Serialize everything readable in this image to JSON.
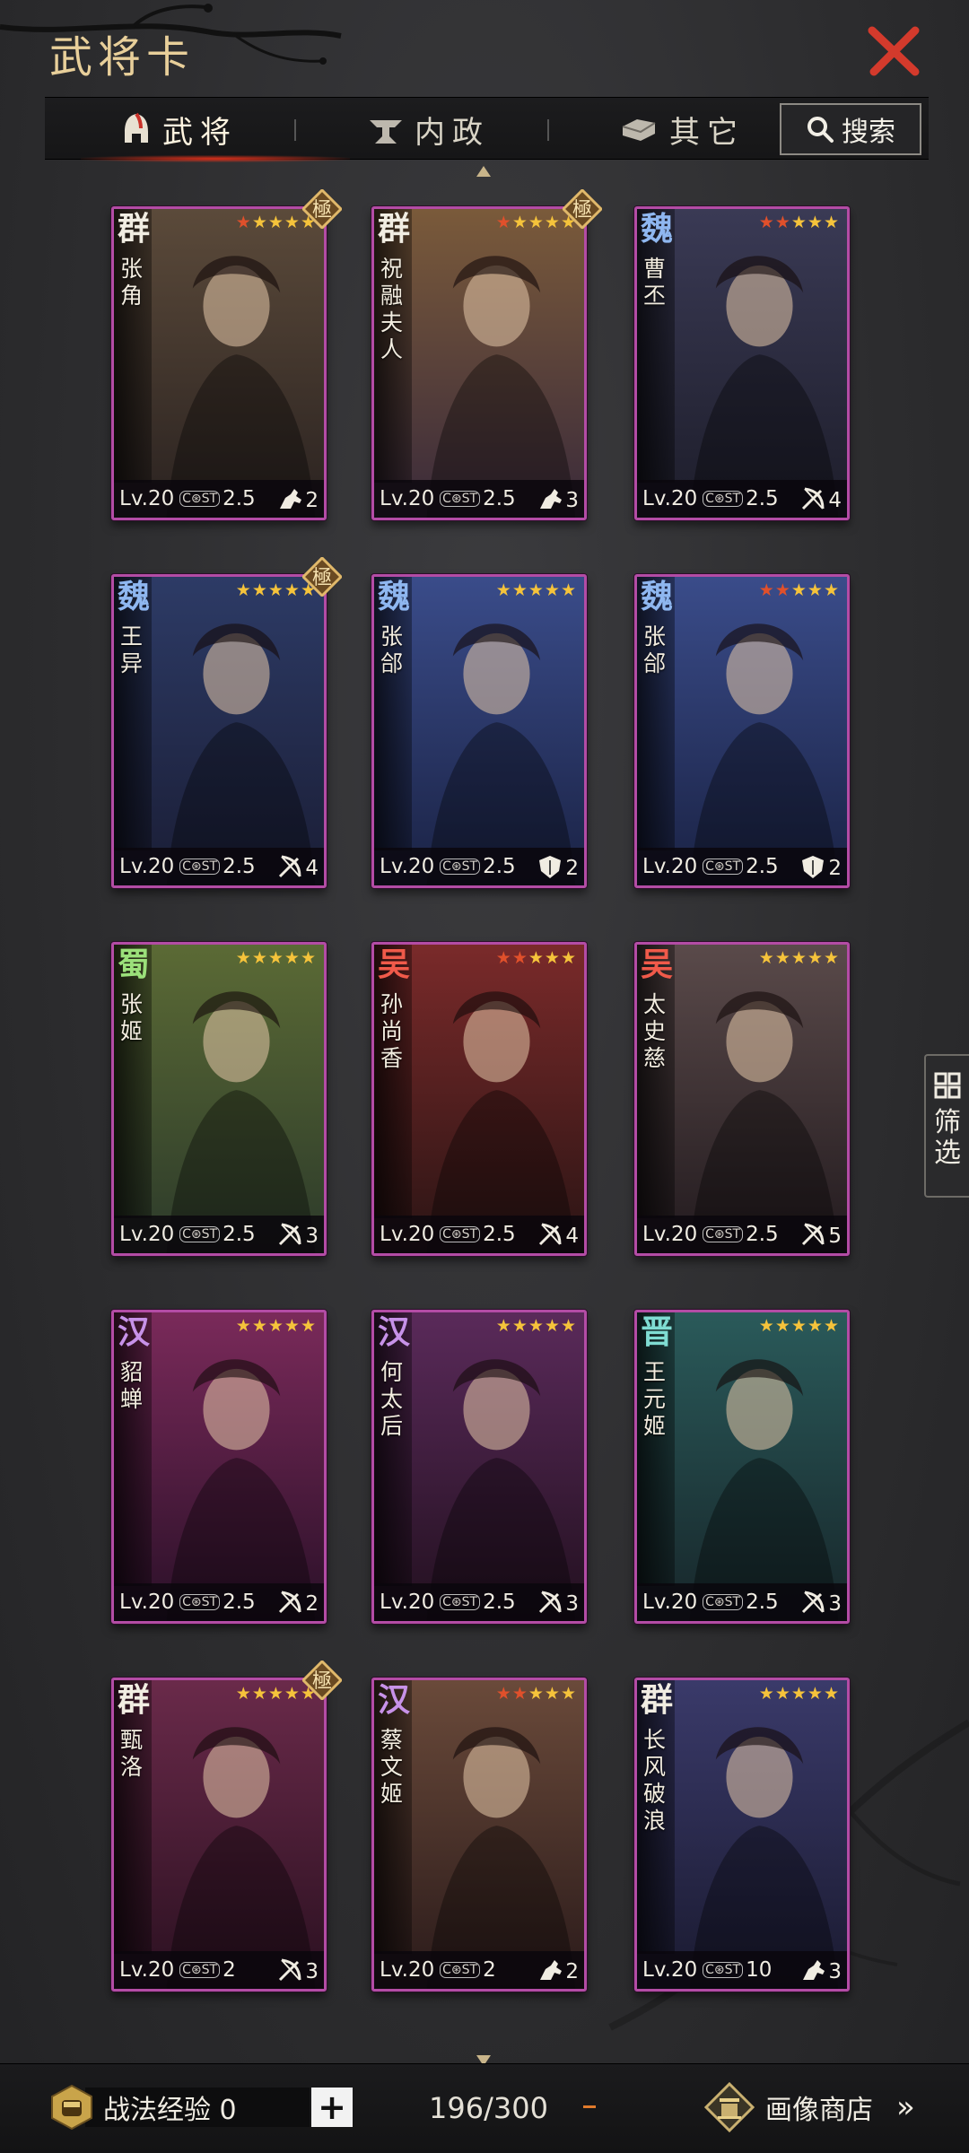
{
  "header": {
    "title": "武将卡"
  },
  "tabs": [
    {
      "label": "武将",
      "icon": "helmet-icon",
      "active": true
    },
    {
      "label": "内政",
      "icon": "anvil-icon",
      "active": false
    },
    {
      "label": "其它",
      "icon": "ingot-icon",
      "active": false
    }
  ],
  "search": {
    "label": "搜索"
  },
  "filter": {
    "label": "筛选"
  },
  "cards": [
    {
      "faction": "群",
      "faction_color": "#f1ede2",
      "name": "张角",
      "stars": 5,
      "red_stars": 1,
      "badge": "極",
      "level": "Lv.20",
      "cost": "2.5",
      "troop_icon": "cavalry-icon",
      "troop_count": "2",
      "art": [
        "#5b4a3a",
        "#2a2220"
      ]
    },
    {
      "faction": "群",
      "faction_color": "#f1ede2",
      "name": "祝融夫人",
      "stars": 5,
      "red_stars": 1,
      "badge": "極",
      "level": "Lv.20",
      "cost": "2.5",
      "troop_icon": "cavalry-icon",
      "troop_count": "3",
      "art": [
        "#7a5a3a",
        "#3a2a3a"
      ]
    },
    {
      "faction": "魏",
      "faction_color": "#8fb7f0",
      "name": "曹丕",
      "stars": 5,
      "red_stars": 2,
      "badge": "",
      "level": "Lv.20",
      "cost": "2.5",
      "troop_icon": "bow-icon",
      "troop_count": "4",
      "art": [
        "#3a3a55",
        "#1d1d2a"
      ]
    },
    {
      "faction": "魏",
      "faction_color": "#8fb7f0",
      "name": "王异",
      "stars": 5,
      "red_stars": 0,
      "badge": "極",
      "level": "Lv.20",
      "cost": "2.5",
      "troop_icon": "bow-icon",
      "troop_count": "4",
      "art": [
        "#2d3b66",
        "#1a1d35"
      ]
    },
    {
      "faction": "魏",
      "faction_color": "#8fb7f0",
      "name": "张郃",
      "stars": 5,
      "red_stars": 0,
      "badge": "",
      "level": "Lv.20",
      "cost": "2.5",
      "troop_icon": "shield-icon",
      "troop_count": "2",
      "art": [
        "#3a4c8a",
        "#1a2244"
      ]
    },
    {
      "faction": "魏",
      "faction_color": "#8fb7f0",
      "name": "张郃",
      "stars": 5,
      "red_stars": 2,
      "badge": "",
      "level": "Lv.20",
      "cost": "2.5",
      "troop_icon": "shield-icon",
      "troop_count": "2",
      "art": [
        "#3a4c8a",
        "#1a2244"
      ]
    },
    {
      "faction": "蜀",
      "faction_color": "#9be07a",
      "name": "张姬",
      "stars": 5,
      "red_stars": 0,
      "badge": "",
      "level": "Lv.20",
      "cost": "2.5",
      "troop_icon": "bow-icon",
      "troop_count": "3",
      "art": [
        "#5b6a35",
        "#2c3a2a"
      ]
    },
    {
      "faction": "吴",
      "faction_color": "#f05a4a",
      "name": "孙尚香",
      "stars": 5,
      "red_stars": 2,
      "badge": "",
      "level": "Lv.20",
      "cost": "2.5",
      "troop_icon": "bow-icon",
      "troop_count": "4",
      "art": [
        "#7a2a2a",
        "#2a1414"
      ]
    },
    {
      "faction": "吴",
      "faction_color": "#f05a4a",
      "name": "太史慈",
      "stars": 5,
      "red_stars": 0,
      "badge": "",
      "level": "Lv.20",
      "cost": "2.5",
      "troop_icon": "bow-icon",
      "troop_count": "5",
      "art": [
        "#5a4a4a",
        "#221a1e"
      ]
    },
    {
      "faction": "汉",
      "faction_color": "#c792e8",
      "name": "貂蝉",
      "stars": 5,
      "red_stars": 0,
      "badge": "",
      "level": "Lv.20",
      "cost": "2.5",
      "troop_icon": "bow-icon",
      "troop_count": "2",
      "art": [
        "#7a2a5a",
        "#2a1028"
      ]
    },
    {
      "faction": "汉",
      "faction_color": "#c792e8",
      "name": "何太后",
      "stars": 5,
      "red_stars": 0,
      "badge": "",
      "level": "Lv.20",
      "cost": "2.5",
      "troop_icon": "bow-icon",
      "troop_count": "3",
      "art": [
        "#5a2a5a",
        "#22101f"
      ]
    },
    {
      "faction": "晋",
      "faction_color": "#7fdcd2",
      "name": "王元姬",
      "stars": 5,
      "red_stars": 0,
      "badge": "",
      "level": "Lv.20",
      "cost": "2.5",
      "troop_icon": "bow-icon",
      "troop_count": "3",
      "art": [
        "#2a5a5a",
        "#17262a"
      ]
    },
    {
      "faction": "群",
      "faction_color": "#f1ede2",
      "name": "甄洛",
      "stars": 5,
      "red_stars": 0,
      "badge": "極",
      "level": "Lv.20",
      "cost": "2",
      "troop_icon": "bow-icon",
      "troop_count": "3",
      "art": [
        "#6a2a4a",
        "#2a1020"
      ]
    },
    {
      "faction": "汉",
      "faction_color": "#c792e8",
      "name": "蔡文姬",
      "stars": 5,
      "red_stars": 2,
      "badge": "",
      "level": "Lv.20",
      "cost": "2",
      "troop_icon": "cavalry-icon",
      "troop_count": "2",
      "art": [
        "#6a4a3a",
        "#2a1a1a"
      ]
    },
    {
      "faction": "群",
      "faction_color": "#f1ede2",
      "name": "长风破浪",
      "stars": 5,
      "red_stars": 0,
      "badge": "",
      "level": "Lv.20",
      "cost": "10",
      "troop_icon": "cavalry-icon",
      "troop_count": "3",
      "art": [
        "#3a3a6a",
        "#1a1a30"
      ]
    }
  ],
  "bottom": {
    "exp_label": "战法经验 0",
    "plus_label": "+",
    "count": "196/300",
    "shop_label": "画像商店",
    "shop_arrow": "»"
  }
}
